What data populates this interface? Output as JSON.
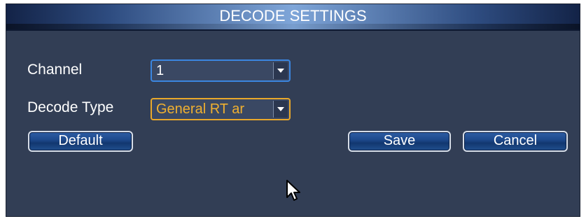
{
  "dialog": {
    "title": "DECODE SETTINGS"
  },
  "fields": {
    "channel_label": "Channel",
    "channel_value": "1",
    "decode_type_label": "Decode Type",
    "decode_type_value": "General RT ar"
  },
  "buttons": {
    "default_label": "Default",
    "save_label": "Save",
    "cancel_label": "Cancel"
  },
  "colors": {
    "panel_bg": "#323e55",
    "title_accent": "#7fa6d9",
    "focus_border": "#e9a82a",
    "combo_border": "#3b86e0"
  },
  "icons": {
    "dropdown": "chevron-down-icon",
    "pointer": "mouse-cursor-icon"
  }
}
